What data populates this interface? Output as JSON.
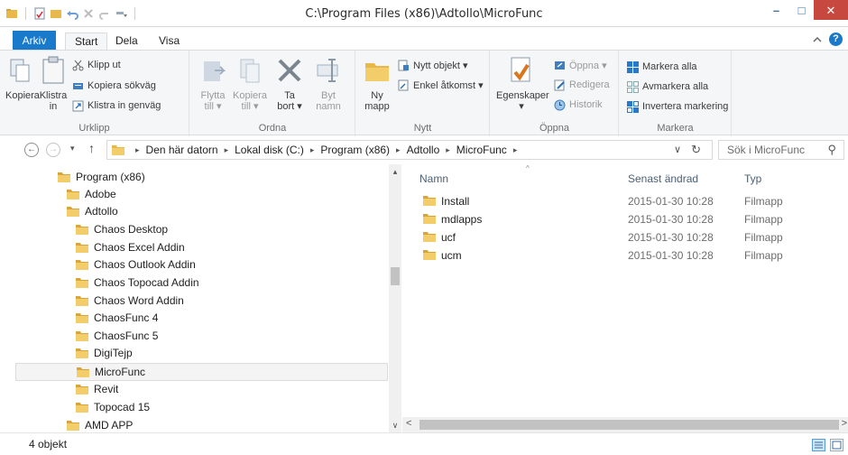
{
  "window": {
    "title": "C:\\Program Files (x86)\\Adtollo\\MicroFunc",
    "minimize_glyph": "–",
    "maximize_glyph": "□",
    "close_glyph": "✕"
  },
  "ribbon_tabs": {
    "file": "Arkiv",
    "start": "Start",
    "share": "Dela",
    "view": "Visa"
  },
  "ribbon": {
    "clipboard": {
      "label": "Urklipp",
      "copy": "Kopiera",
      "paste_line1": "Klistra",
      "paste_line2": "in",
      "cut": "Klipp ut",
      "copy_path": "Kopiera sökväg",
      "paste_shortcut": "Klistra in genväg"
    },
    "organize": {
      "label": "Ordna",
      "move_line1": "Flytta",
      "move_line2": "till ▾",
      "copyto_line1": "Kopiera",
      "copyto_line2": "till ▾",
      "delete_line1": "Ta",
      "delete_line2": "bort ▾",
      "rename_line1": "Byt",
      "rename_line2": "namn"
    },
    "new": {
      "label": "Nytt",
      "new_folder_line1": "Ny",
      "new_folder_line2": "mapp",
      "new_item": "Nytt objekt ▾",
      "easy_access": "Enkel åtkomst ▾"
    },
    "open": {
      "label": "Öppna",
      "properties_line1": "Egenskaper",
      "properties_line2": "▾",
      "open": "Öppna ▾",
      "edit": "Redigera",
      "history": "Historik"
    },
    "select": {
      "label": "Markera",
      "select_all": "Markera alla",
      "select_none": "Avmarkera alla",
      "invert": "Invertera markering"
    }
  },
  "address": {
    "back_glyph": "←",
    "forward_glyph": "→",
    "recent_glyph": "▾",
    "up_glyph": "↑",
    "crumbs": [
      "Den här datorn",
      "Lokal disk (C:)",
      "Program (x86)",
      "Adtollo",
      "MicroFunc"
    ],
    "sep": "▸",
    "dropdown_glyph": "∨",
    "refresh_glyph": "↻",
    "search_placeholder": "Sök i MicroFunc",
    "search_glyph": "⚲"
  },
  "tree": [
    {
      "label": "Program (x86)",
      "level": 0
    },
    {
      "label": "Adobe",
      "level": 1
    },
    {
      "label": "Adtollo",
      "level": 1
    },
    {
      "label": "Chaos Desktop",
      "level": 2
    },
    {
      "label": "Chaos Excel Addin",
      "level": 2
    },
    {
      "label": "Chaos Outlook Addin",
      "level": 2
    },
    {
      "label": "Chaos Topocad Addin",
      "level": 2
    },
    {
      "label": "Chaos Word Addin",
      "level": 2
    },
    {
      "label": "ChaosFunc 4",
      "level": 2
    },
    {
      "label": "ChaosFunc 5",
      "level": 2
    },
    {
      "label": "DigiTejp",
      "level": 2
    },
    {
      "label": "MicroFunc",
      "level": 2,
      "selected": true
    },
    {
      "label": "Revit",
      "level": 2
    },
    {
      "label": "Topocad 15",
      "level": 2
    },
    {
      "label": "AMD APP",
      "level": 1
    }
  ],
  "columns": {
    "name": "Namn",
    "modified": "Senast ändrad",
    "type": "Typ",
    "sort_glyph": "^"
  },
  "files": [
    {
      "name": "Install",
      "modified": "2015-01-30 10:28",
      "type": "Filmapp"
    },
    {
      "name": "mdlapps",
      "modified": "2015-01-30 10:28",
      "type": "Filmapp"
    },
    {
      "name": "ucf",
      "modified": "2015-01-30 10:28",
      "type": "Filmapp"
    },
    {
      "name": "ucm",
      "modified": "2015-01-30 10:28",
      "type": "Filmapp"
    }
  ],
  "scroll_glyphs": {
    "up": "▴",
    "down": "∨",
    "left": "<",
    "right": ">"
  },
  "status": {
    "item_count": "4 objekt"
  },
  "colors": {
    "accent": "#1979ca",
    "close": "#c7483f",
    "folder": "#e8b84a"
  }
}
